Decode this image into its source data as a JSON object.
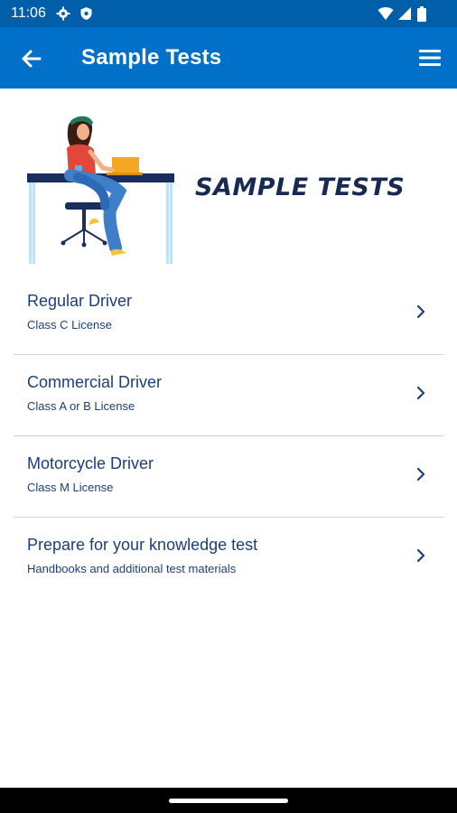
{
  "status_bar": {
    "time": "11:06"
  },
  "app_bar": {
    "title": "Sample Tests"
  },
  "hero": {
    "title": "SAMPLE TESTS"
  },
  "items": [
    {
      "label": "Regular Driver",
      "sub": "Class C License"
    },
    {
      "label": "Commercial Driver",
      "sub": "Class A or B License"
    },
    {
      "label": "Motorcycle Driver",
      "sub": "Class M License"
    },
    {
      "label": "Prepare for your knowledge test",
      "sub": "Handbooks and additional test materials"
    }
  ],
  "icons": {
    "status": [
      "gear-icon",
      "shield-icon",
      "wifi-icon",
      "signal-icon",
      "battery-icon"
    ],
    "app_bar": [
      "back-arrow-icon",
      "menu-icon"
    ],
    "list": "chevron-right-icon"
  },
  "colors": {
    "status_bar": "#005fa8",
    "app_bar": "#0070c9",
    "hero_title": "#172a54",
    "item_text": "#1d3f78",
    "divider": "#c9d8e4"
  }
}
